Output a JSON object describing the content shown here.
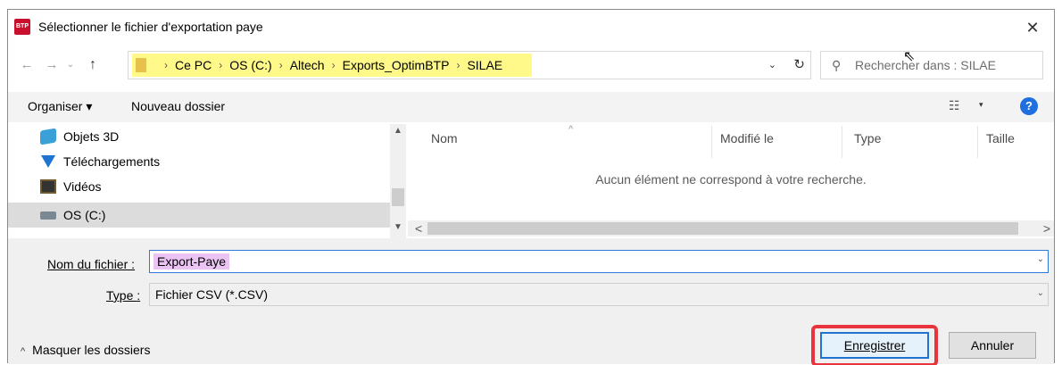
{
  "window": {
    "title": "Sélectionner le fichier d'exportation paye",
    "app_icon_text": "BTP",
    "close_glyph": "✕"
  },
  "nav_buttons": {
    "back": "←",
    "forward": "→",
    "recent": "⌄",
    "up": "↑"
  },
  "address": {
    "crumbs": [
      "Ce PC",
      "OS (C:)",
      "Altech",
      "Exports_OptimBTP",
      "SILAE"
    ],
    "separator": "›",
    "dropdown_glyph": "⌄",
    "refresh_glyph": "↻"
  },
  "search": {
    "placeholder": "Rechercher dans : SILAE",
    "icon_glyph": "⚲"
  },
  "toolbar": {
    "organize_label": "Organiser ▾",
    "new_folder_label": "Nouveau dossier",
    "view_glyph": "☷",
    "view_arrow": "▾",
    "help_glyph": "?"
  },
  "nav_pane": {
    "items": [
      {
        "label": "Objets 3D",
        "icon": "cube-3d-icon",
        "selected": false
      },
      {
        "label": "Téléchargements",
        "icon": "download-arrow-icon",
        "selected": false
      },
      {
        "label": "Vidéos",
        "icon": "video-film-icon",
        "selected": false
      },
      {
        "label": "OS (C:)",
        "icon": "drive-icon",
        "selected": true
      }
    ]
  },
  "file_list": {
    "columns": {
      "name": "Nom",
      "modified": "Modifié le",
      "type": "Type",
      "size": "Taille"
    },
    "sort_caret": "^",
    "empty_message": "Aucun élément ne correspond à votre recherche."
  },
  "scrollbars": {
    "up": "▲",
    "down": "▼",
    "left": "<",
    "right": ">"
  },
  "form": {
    "filename_label": "Nom du fichier :",
    "filename_value": "Export-Paye",
    "filename_caret": "⌄",
    "type_label": "Type :",
    "type_value": "Fichier CSV (*.CSV)",
    "type_caret": "⌄"
  },
  "footer": {
    "hide_folders_caret": "^",
    "hide_folders_label": "Masquer les dossiers",
    "save_label": "Enregistrer",
    "cancel_label": "Annuler"
  },
  "colors": {
    "address_highlight": "#fff98a",
    "filename_highlight": "#ecc4f4",
    "save_callout": "#e8343c",
    "accent": "#1f73d1"
  }
}
